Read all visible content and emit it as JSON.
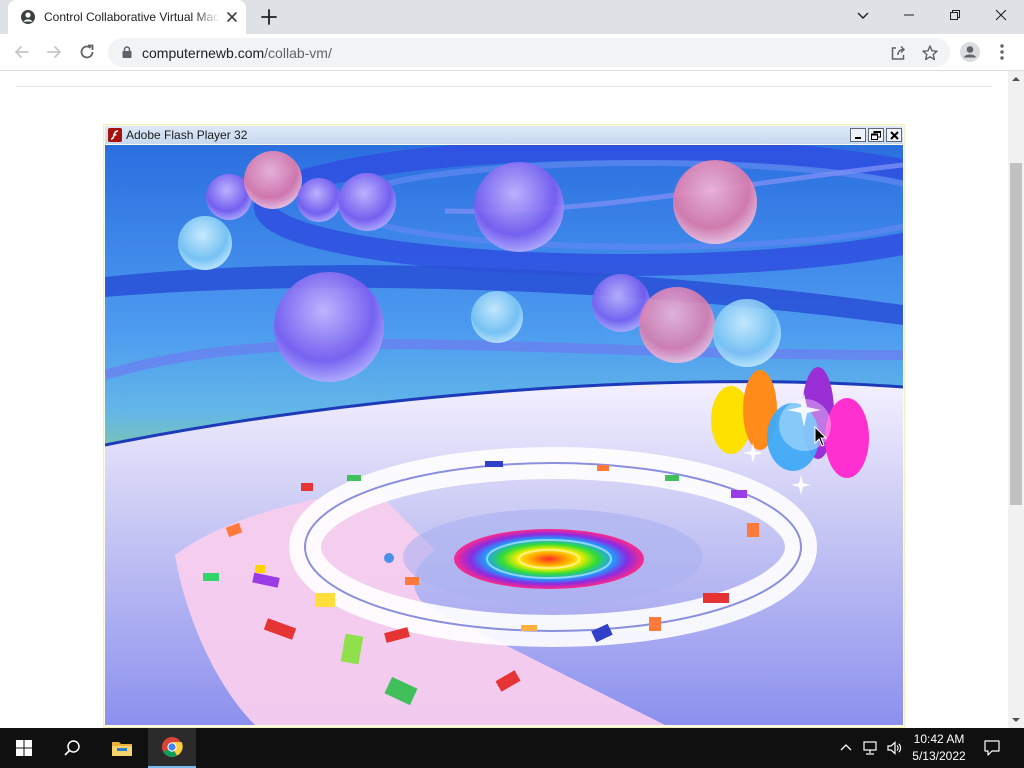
{
  "browser": {
    "tab": {
      "title": "Control Collaborative Virtual Machine"
    },
    "address": {
      "host": "computernewb.com",
      "path": "/collab-vm/"
    }
  },
  "flash": {
    "window_title": "Adobe Flash Player 32"
  },
  "taskbar": {
    "time": "10:42 AM",
    "date": "5/13/2022"
  },
  "colors": {
    "chrome_frame": "#dee1e6",
    "flash_titlebar": "#c7d8ee",
    "taskbar": "#101010",
    "taskbar_active_indicator": "#76b9ed"
  },
  "icons": {
    "tab_favicon": "vm-favicon-icon",
    "tab_close": "close-icon",
    "new_tab": "plus-icon",
    "back": "back-arrow-icon",
    "forward": "forward-arrow-icon",
    "reload": "reload-icon",
    "lock": "lock-icon",
    "share": "share-icon",
    "bookmark": "star-icon",
    "profile": "profile-icon",
    "menu": "kebab-menu-icon",
    "start": "windows-start-icon",
    "search": "search-icon",
    "file_explorer": "folder-icon",
    "chrome": "chrome-icon",
    "tray_overflow": "chevron-up-icon",
    "network": "network-icon",
    "volume": "volume-icon",
    "notifications": "notification-icon"
  }
}
